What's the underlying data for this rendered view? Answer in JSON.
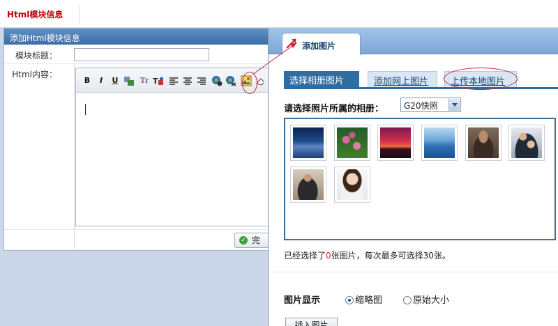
{
  "topbar": {
    "title": "Html模块信息"
  },
  "form": {
    "panel_title": "添加Html模块信息",
    "title_label": "模块标题：",
    "title_value": "",
    "content_label": "Html内容：",
    "toolbar_buttons": [
      "B",
      "I",
      "U",
      "Tr"
    ],
    "done_label": "完"
  },
  "dialog": {
    "title": "添加图片",
    "tabs": [
      "选择相册图片",
      "添加网上图片",
      "上传本地图片"
    ],
    "active_tab": "选择相册图片",
    "album_label": "请选择照片所属的相册：",
    "album_value": "G20快照",
    "photos": [
      "blue-waves-thumb",
      "flowers-thumb",
      "sunset-thumb",
      "blue-mountains-thumb",
      "man-portrait-thumb",
      "couple-thumb",
      "speaker-thumb",
      "woman-portrait-thumb"
    ],
    "selection_info_prefix": "已经选择了",
    "selection_count": "0",
    "selection_info_mid": "张图片，每次最多可选择",
    "selection_max": "30",
    "selection_info_suffix": "张。",
    "display_label": "图片显示",
    "display_options": [
      "缩略图",
      "原始大小"
    ],
    "display_selected": "缩略图",
    "insert_label": "插入图片"
  },
  "colors": {
    "title_red": "#c0000a",
    "header_blue": "#3c6ea8",
    "tab_blue": "#2f6da3",
    "annotation_red": "#d0203a"
  }
}
